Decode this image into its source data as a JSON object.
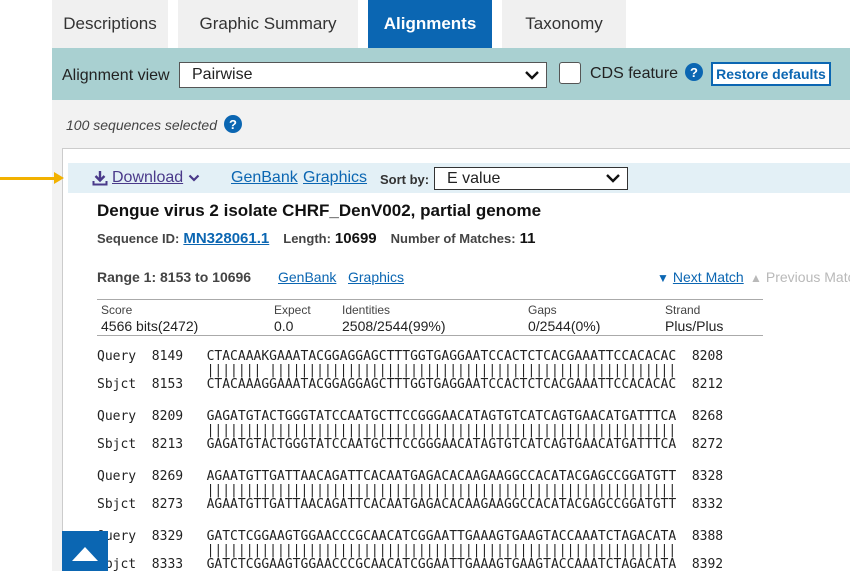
{
  "tabs": [
    {
      "label": "Descriptions"
    },
    {
      "label": "Graphic Summary"
    },
    {
      "label": "Alignments"
    },
    {
      "label": "Taxonomy"
    }
  ],
  "alignment_view": {
    "label": "Alignment view",
    "selected": "Pairwise",
    "cds_label": "CDS feature",
    "restore_label": "Restore defaults"
  },
  "selection": {
    "text": "100 sequences selected"
  },
  "download_bar": {
    "download_label": "Download",
    "genbank_label": "GenBank",
    "graphics_label": "Graphics",
    "sort_label": "Sort by:",
    "sort_selected": "E value"
  },
  "hit": {
    "title": "Dengue virus 2 isolate CHRF_DenV002, partial genome",
    "seqid_label": "Sequence ID:",
    "seqid": "MN328061.1",
    "length_label": "Length:",
    "length": "10699",
    "matches_label": "Number of Matches:",
    "matches": "11"
  },
  "range": {
    "label": "Range 1: 8153 to 10696",
    "genbank_label": "GenBank",
    "graphics_label": "Graphics",
    "next_label": "Next Match",
    "prev_label": "Previous Match"
  },
  "stats": {
    "score_h": "Score",
    "score": "4566 bits(2472)",
    "expect_h": "Expect",
    "expect": "0.0",
    "ident_h": "Identities",
    "ident": "2508/2544(99%)",
    "gaps_h": "Gaps",
    "gaps": "0/2544(0%)",
    "strand_h": "Strand",
    "strand": "Plus/Plus"
  },
  "alignment_blocks": [
    {
      "q": "Query  8149   CTACAAAKGAAATACGGAGGAGCTTTGGTGAGGAATCCACTCTCACGAAATTCCACACAC  8208",
      "m": "              ||||||| ||||||||||||||||||||||||||||||||||||||||||||||||||||",
      "s": "Sbjct  8153   CTACAAAGGAAATACGGAGGAGCTTTGGTGAGGAATCCACTCTCACGAAATTCCACACAC  8212"
    },
    {
      "q": "Query  8209   GAGATGTACTGGGTATCCAATGCTTCCGGGAACATAGTGTCATCAGTGAACATGATTTCA  8268",
      "m": "              ||||||||||||||||||||||||||||||||||||||||||||||||||||||||||||",
      "s": "Sbjct  8213   GAGATGTACTGGGTATCCAATGCTTCCGGGAACATAGTGTCATCAGTGAACATGATTTCA  8272"
    },
    {
      "q": "Query  8269   AGAATGTTGATTAACAGATTCACAATGAGACACAAGAAGGCCACATACGAGCCGGATGTT  8328",
      "m": "              ||||||||||||||||||||||||||||||||||||||||||||||||||||||||||||",
      "s": "Sbjct  8273   AGAATGTTGATTAACAGATTCACAATGAGACACAAGAAGGCCACATACGAGCCGGATGTT  8332"
    },
    {
      "q": "Query  8329   GATCTCGGAAGTGGAACCCGCAACATCGGAATTGAAAGTGAAGTACCAAATCTAGACATA  8388",
      "m": "              ||||||||||||||||||||||||||||||||||||||||||||||||||||||||||||",
      "s": "Sbjct  8333   GATCTCGGAAGTGGAACCCGCAACATCGGAATTGAAAGTGAAGTACCAAATCTAGACATA  8392"
    }
  ],
  "colors": {
    "accent": "#0b66b2",
    "viewbar": "#a9d0d1",
    "arrow": "#f2b100"
  }
}
